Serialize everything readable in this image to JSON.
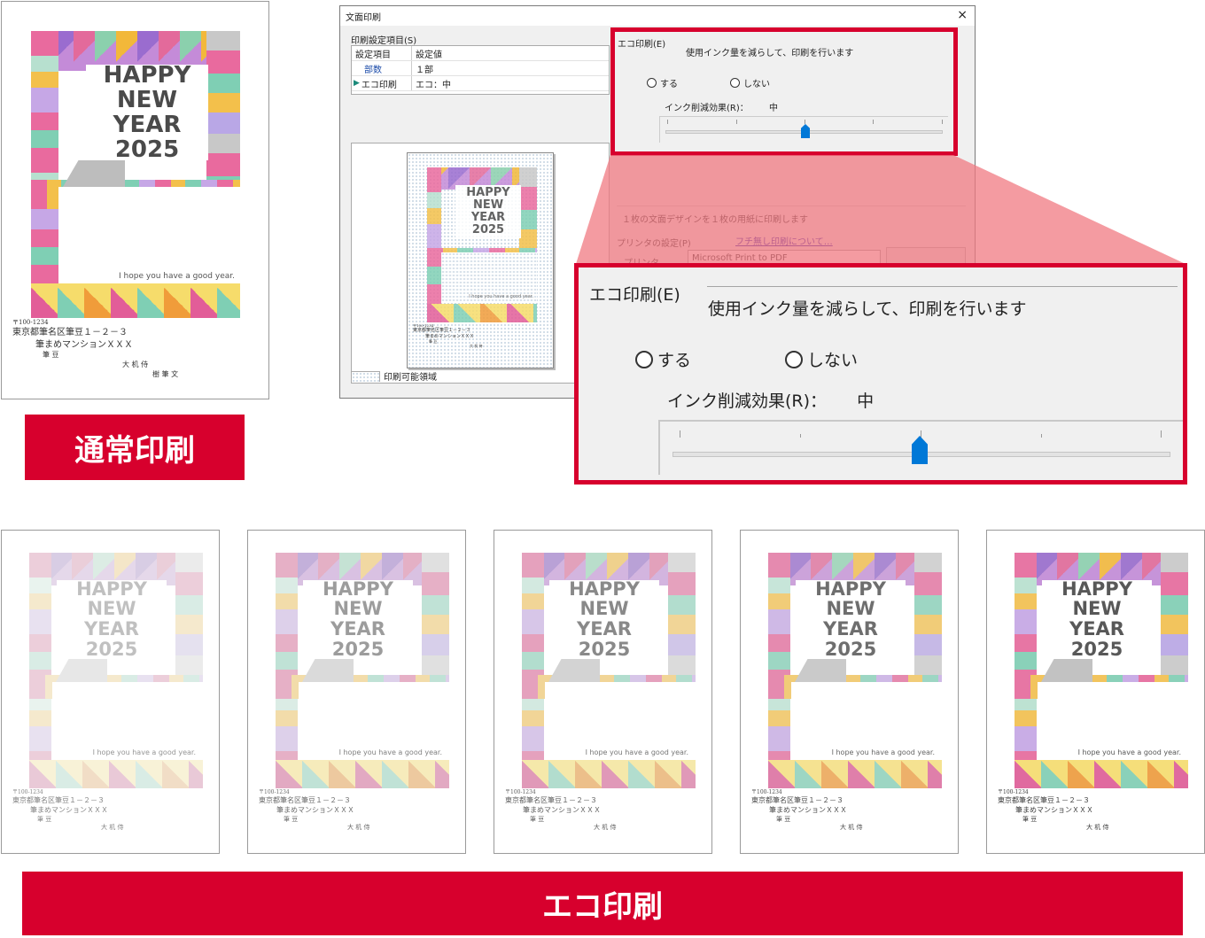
{
  "top_label": "通常印刷",
  "bottom_label": "エコ印刷",
  "card": {
    "happy": "HAPPY",
    "new_year": "NEW YEAR",
    "year": "2025",
    "greeting": "I hope you have a good year.",
    "postal": "〒100-1234",
    "addr1": "東京都筆名区筆豆１－２－３",
    "addr2": "筆まめマンションＸＸＸ",
    "names": "筆 豆",
    "sender": "大 机 侍",
    "sender2": "樹 筆 文"
  },
  "dialog": {
    "title": "文面印刷",
    "close": "×",
    "settings_label": "印刷設定項目(S)",
    "col_item": "設定項目",
    "col_value": "設定値",
    "row1_item": "部数",
    "row1_value": "１部",
    "row2_item": "エコ印刷",
    "row2_value": "エコ：中",
    "printable_area": "印刷可能領域",
    "eco_group": "エコ印刷(E)",
    "eco_desc": "使用インク量を減らして、印刷を行います",
    "radio_on": "する",
    "radio_off": "しない",
    "ink_label": "インク削減効果(R)：",
    "ink_value": "中",
    "layout_note": "１枚の文面デザインを１枚の用紙に印刷します",
    "printer_label": "プリンタの設定(P)",
    "borderless_link": "フチ無し印刷について…",
    "printer_field": "プリンタ",
    "printer_value": "Microsoft Print to PDF"
  },
  "zoom": {
    "eco_group": "エコ印刷(E)",
    "eco_desc": "使用インク量を減らして、印刷を行います",
    "radio_on": "する",
    "radio_off": "しない",
    "ink_label": "インク削減効果(R)：",
    "ink_value": "中"
  },
  "eco_levels": [
    0.35,
    0.55,
    0.65,
    0.8,
    0.92
  ]
}
